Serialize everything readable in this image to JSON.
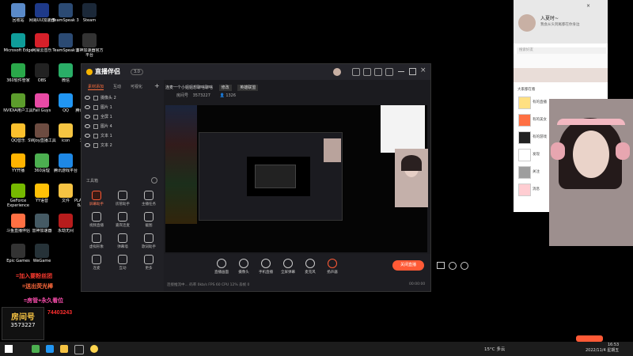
{
  "desktop_icons": [
    {
      "label": "回收站",
      "color": "#5a8ac9"
    },
    {
      "label": "网易UU加速器",
      "color": "#1e3a8a"
    },
    {
      "label": "TeamSpeak 3",
      "color": "#2b4a73"
    },
    {
      "label": "Steam",
      "color": "#1b2838"
    },
    {
      "label": "Microsoft Edge",
      "color": "#0f9d9a"
    },
    {
      "label": "网易云音乐",
      "color": "#d6202a"
    },
    {
      "label": "TeamSpeak 3",
      "color": "#2b4a73"
    },
    {
      "label": "雷神加速器官方平台",
      "color": "#333"
    },
    {
      "label": "360软件管家",
      "color": "#2aa84a"
    },
    {
      "label": "OBS",
      "color": "#222"
    },
    {
      "label": "微信",
      "color": "#2aae67"
    },
    {
      "label": "网易大师",
      "color": "#1565c0"
    },
    {
      "label": "NVIDIA用户工具",
      "color": "#5c9c2c"
    },
    {
      "label": "Fall Guys",
      "color": "#e84aa5"
    },
    {
      "label": "QQ",
      "color": "#2196f3"
    },
    {
      "label": "腾讯网游加速器",
      "color": "#1e88e5"
    },
    {
      "label": "QQ音乐",
      "color": "#fbc02d"
    },
    {
      "label": "SWJoy直播工具",
      "color": "#6d4c41"
    },
    {
      "label": "icon",
      "color": "#f5c542"
    },
    {
      "label": "360加速球",
      "color": "#43a047"
    },
    {
      "label": "YY开播",
      "color": "#ffb300"
    },
    {
      "label": "360清理",
      "color": "#4caf50"
    },
    {
      "label": "腾讯游戏平台",
      "color": "#1e88e5"
    },
    {
      "label": "剑网3",
      "color": "#3949ab"
    },
    {
      "label": "GeForce Experience",
      "color": "#76b900"
    },
    {
      "label": "YY语音",
      "color": "#ffc107"
    },
    {
      "label": "文件",
      "color": "#f6c343"
    },
    {
      "label": "PLAYERUNKNOWN'S BATTLEGR...",
      "color": "#e0a030"
    },
    {
      "label": "斗鱼直播伴侣",
      "color": "#ff7043"
    },
    {
      "label": "雷神加速器",
      "color": "#455a64"
    },
    {
      "label": "永劫无间",
      "color": "#b71c1c"
    },
    {
      "label": "EPIC",
      "color": "#222"
    },
    {
      "label": "Epic Games",
      "color": "#333"
    },
    {
      "label": "WeGame",
      "color": "#263238"
    }
  ],
  "overlay": {
    "line1": "=加入要粉丝团",
    "line2": "=送出荧光棒",
    "line3": "=房管+永久看位",
    "line4": "74403243",
    "room_label": "房间号",
    "room_id": "3573227"
  },
  "app": {
    "name": "直播伴侣",
    "version": "3.0",
    "side_tabs": [
      "素材添加",
      "互动",
      "可视化"
    ],
    "scenes": [
      "摄像头 2",
      "图片 1",
      "全屏 1",
      "图片 4",
      "文本 1",
      "文本 2"
    ],
    "tools_header": "工具箱",
    "tools": [
      "屏幕助手",
      "房管助手",
      "主播任务",
      "视频直播",
      "嘉宾连麦",
      "截图",
      "虚拟形象",
      "弹幕墙",
      "歌词助手",
      "连麦",
      "互动",
      "更多"
    ],
    "stream_title": "连麦一个小姐姐想聊啥聊啥",
    "edit_label": "修改",
    "category": "英雄联盟",
    "room_label": "房间号",
    "room_id": "3573227",
    "count": "1326",
    "bottom_buttons": [
      "直播画面",
      "摄像头",
      "手机直播",
      "全屏弹幕",
      "麦克风",
      "扬声器"
    ],
    "go_live": "关闭直播",
    "status_line": "连接推流中... 码率 0kb/s  FPS 60  CPU 12%  丢帧 0",
    "timer": "00:00:00"
  },
  "chat": {
    "username": "入夏时~",
    "subtitle": "我会从头到尾都在你身边",
    "search_placeholder": "搜索好友",
    "section_label": "大家都在看",
    "items": [
      "有的直播",
      "有的美女",
      "有的游戏",
      "发现",
      "关注",
      "消息"
    ]
  },
  "taskbar": {
    "weather": "15°C 多云",
    "time": "16:53",
    "date": "2022/11/4 星期五"
  },
  "colors": {
    "accent": "#ff5a36",
    "brand": "#f7b500"
  }
}
